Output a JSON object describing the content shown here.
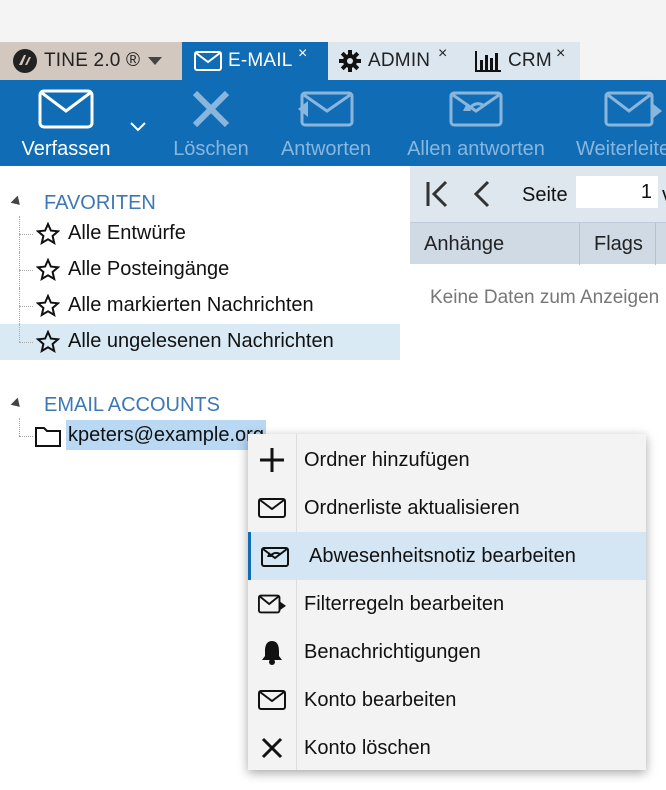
{
  "tabs": [
    {
      "label": "TINE 2.0 ®",
      "active": false
    },
    {
      "label": "E-MAIL",
      "close": "×",
      "active": true
    },
    {
      "label": "ADMIN",
      "close": "×",
      "active": false
    },
    {
      "label": "CRM",
      "close": "×",
      "active": false
    }
  ],
  "toolbar": {
    "compose": "Verfassen",
    "delete": "Löschen",
    "reply": "Antworten",
    "reply_all": "Allen antworten",
    "forward": "Weiterleiten"
  },
  "tree": {
    "favorites_header": "FAVORITEN",
    "favorites": [
      {
        "label": "Alle Entwürfe"
      },
      {
        "label": "Alle Posteingänge"
      },
      {
        "label": "Alle markierten Nachrichten"
      },
      {
        "label": "Alle ungelesenen Nachrichten"
      }
    ],
    "accounts_header": "EMAIL ACCOUNTS",
    "account": "kpeters@example.org"
  },
  "pager": {
    "page_label": "Seite",
    "page_value": "1",
    "of_label": "von"
  },
  "grid": {
    "columns": [
      "Anhänge",
      "Flags"
    ],
    "empty_text": "Keine Daten zum Anzeigen"
  },
  "context_menu": [
    {
      "label": "Ordner hinzufügen",
      "icon": "plus-icon"
    },
    {
      "label": "Ordnerliste aktualisieren",
      "icon": "envelope-icon"
    },
    {
      "label": "Abwesenheitsnotiz bearbeiten",
      "icon": "envelope-return-icon"
    },
    {
      "label": "Filterregeln bearbeiten",
      "icon": "envelope-forward-icon"
    },
    {
      "label": "Benachrichtigungen",
      "icon": "bell-icon"
    },
    {
      "label": "Konto bearbeiten",
      "icon": "envelope-icon"
    },
    {
      "label": "Konto löschen",
      "icon": "close-icon"
    }
  ],
  "colors": {
    "accent": "#0f6cb5",
    "selected": "#d9eaf5",
    "tree_header": "#3d78b5"
  }
}
